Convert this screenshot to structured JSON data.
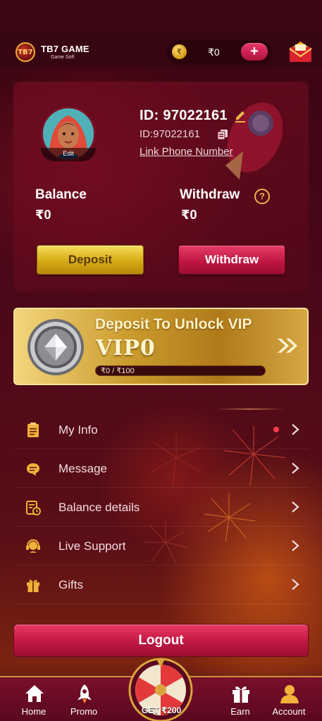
{
  "header": {
    "brand_badge": "TB7",
    "brand_name": "TB7 GAME",
    "brand_sub": "Game Soft",
    "coin_symbol": "₹",
    "wallet_amount": "₹0",
    "plus_label": "+"
  },
  "profile": {
    "avatar_edit": "Edit",
    "id_main": "ID: 97022161",
    "id_sub": "ID:97022161",
    "link_phone": "Link Phone Number",
    "balance_label": "Balance",
    "balance_value": "₹0",
    "withdraw_label": "Withdraw",
    "help_symbol": "?",
    "withdraw_value": "₹0",
    "deposit_button": "Deposit",
    "withdraw_button": "Withdraw"
  },
  "vip": {
    "title": "Deposit To Unlock VIP",
    "level": "VIP0",
    "progress_text": "₹0 / ₹100",
    "progress_fraction": 0.0
  },
  "menu": {
    "items": [
      {
        "label": "My Info",
        "icon": "clipboard-icon",
        "has_dot": true
      },
      {
        "label": "Message",
        "icon": "chat-bubble-icon",
        "has_dot": false
      },
      {
        "label": "Balance details",
        "icon": "statement-clock-icon",
        "has_dot": false
      },
      {
        "label": "Live Support",
        "icon": "headset-icon",
        "has_dot": false
      },
      {
        "label": "Gifts",
        "icon": "gift-icon",
        "has_dot": false
      }
    ]
  },
  "logout_label": "Logout",
  "bottom_nav": {
    "home": "Home",
    "promo": "Promo",
    "center": "GET ₹200",
    "earn": "Earn",
    "account": "Account"
  },
  "colors": {
    "background": "#3d0614",
    "accent_red": "#c11743",
    "accent_gold": "#d7aa16",
    "notification_dot": "#ff3c4a"
  }
}
